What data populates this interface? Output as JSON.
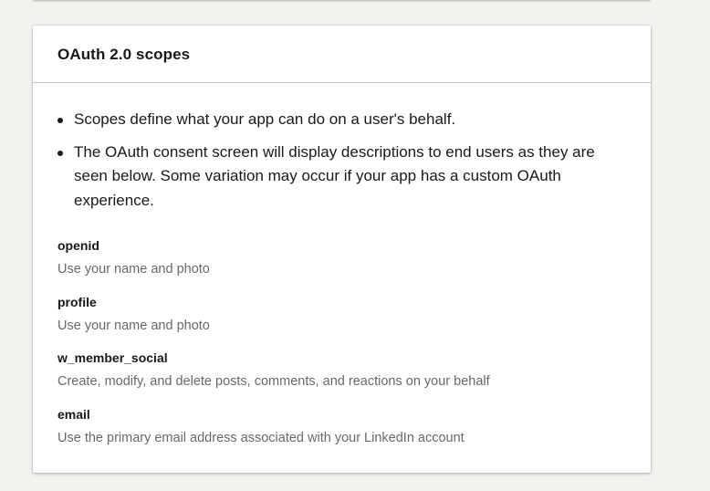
{
  "card": {
    "title": "OAuth 2.0 scopes",
    "notes": [
      "Scopes define what your app can do on a user's behalf.",
      "The OAuth consent screen will display descriptions to end users as they are seen below. Some variation may occur if your app has a custom OAuth experience."
    ],
    "scopes": [
      {
        "name": "openid",
        "description": "Use your name and photo"
      },
      {
        "name": "profile",
        "description": "Use your name and photo"
      },
      {
        "name": "w_member_social",
        "description": "Create, modify, and delete posts, comments, and reactions on your behalf"
      },
      {
        "name": "email",
        "description": "Use the primary email address associated with your LinkedIn account"
      }
    ]
  },
  "colors": {
    "page_background": "#f3f2ef",
    "card_background": "#ffffff",
    "divider": "#c4c4c4",
    "secondary_text": "#666666"
  }
}
